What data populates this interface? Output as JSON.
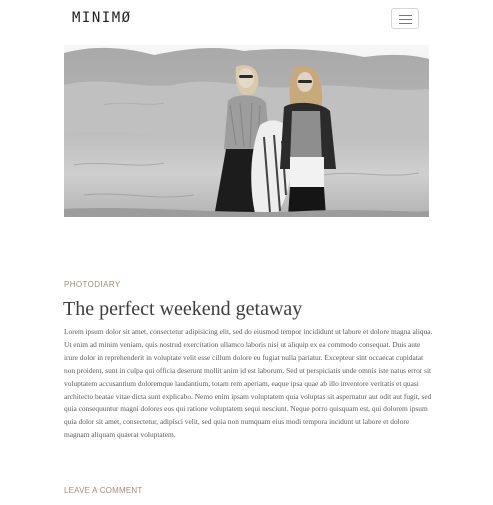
{
  "header": {
    "logo": "MINIMØ",
    "menu_icon": "hamburger-menu-icon"
  },
  "hero": {
    "slide_count": 3,
    "active_slide": 1
  },
  "post": {
    "category": "PHOTODIARY",
    "title": "The perfect weekend getaway",
    "body": "Lorem ipsum dolor sit amet, consectetur adipisicing elit, sed do eiusmod tempor incididunt ut labore et dolore magna aliqua. Ut enim ad minim veniam, quis nostrud exercitation ullamco laboris nisi ut aliquip ex ea commodo consequat. Duis aute irure dolor in reprehenderit in voluptate velit esse cillum dolore eu fugiat nulla pariatur. Excepteur sint occaecat cupidatat non proident, sunt in culpa qui officia deserunt mollit anim id est laborum. Sed ut perspiciatis unde omnis iste natus error sit voluptatem accusantium doloremque laudantium, totam rem aperiam, eaque ipsa quae ab illo inventore veritatis et quasi architecto beatae vitae dicta sunt explicabo. Nemo enim ipsam voluptatem quia voluptas sit aspernatur aut odit aut fugit, sed quia consequuntur magni dolores eos qui ratione voluptatem sequi nesciunt. Neque porro quisquam est, qui dolorem ipsum quia dolor sit amet, consectetur, adipisci velit, sed quia non numquam eius modi tempora incidunt ut labore et dolore magnam aliquam quaerat voluptatem.",
    "comment_link": "LEAVE A COMMENT"
  },
  "colors": {
    "accent": "#a58d77",
    "title": "#3d3d3d",
    "text": "#5a5a5a"
  }
}
